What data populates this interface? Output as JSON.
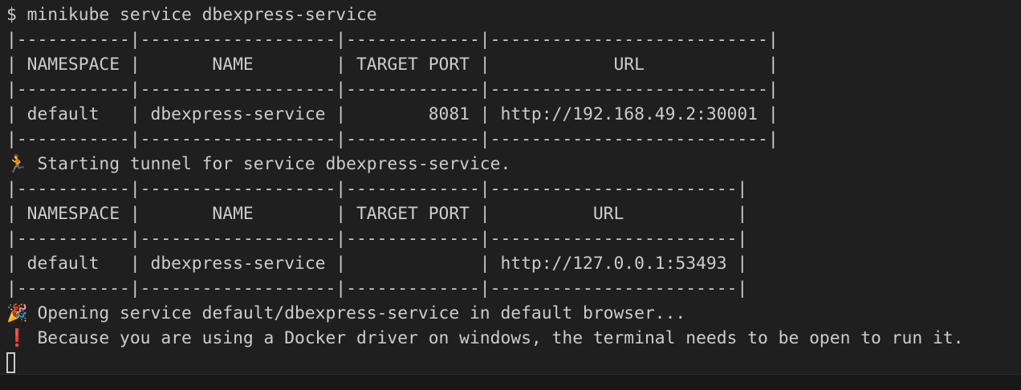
{
  "terminal": {
    "command_line": "$ minikube service dbexpress-service",
    "table1": {
      "border": "|-----------|-------------------|-------------|---------------------------|",
      "header": "| NAMESPACE |       NAME        | TARGET PORT |            URL            |",
      "row": "| default   | dbexpress-service |        8081 | http://192.168.49.2:30001 |"
    },
    "tunnel_msg": {
      "icon": "running-person-emoji",
      "glyph": "🏃",
      "text": "Starting tunnel for service dbexpress-service."
    },
    "table2": {
      "border": "|-----------|-------------------|-------------|------------------------|",
      "header": "| NAMESPACE |       NAME        | TARGET PORT |          URL           |",
      "row": "| default   | dbexpress-service |             | http://127.0.0.1:53493 |"
    },
    "opening_msg": {
      "icon": "party-popper-emoji",
      "glyph": "🎉",
      "text": "Opening service default/dbexpress-service in default browser..."
    },
    "warning_msg": {
      "icon": "exclamation-emoji",
      "glyph": "❗",
      "text": "Because you are using a Docker driver on windows, the terminal needs to be open to run it."
    }
  },
  "colors": {
    "background": "#1f1f1f",
    "foreground": "#cccccc",
    "warning_icon": "#e51400",
    "tunnel_icon": "#f5a623"
  }
}
